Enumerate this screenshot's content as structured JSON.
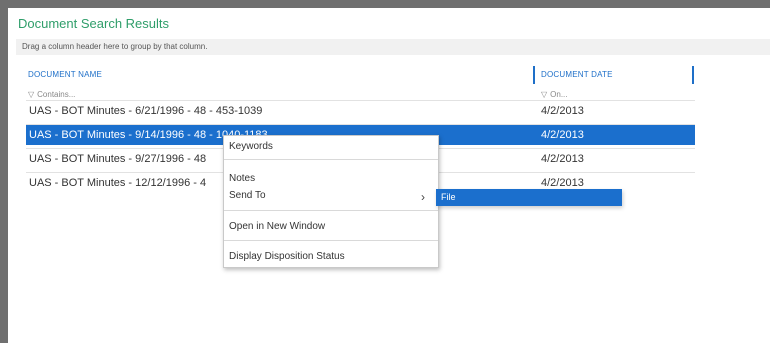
{
  "panel": {
    "title": "Document Search Results",
    "group_hint": "Drag a column header here to group by that column."
  },
  "columns": {
    "name": {
      "header": "DOCUMENT NAME",
      "filter_placeholder": "Contains..."
    },
    "date": {
      "header": "DOCUMENT DATE",
      "filter_placeholder": "On..."
    }
  },
  "rows": [
    {
      "name": "UAS - BOT Minutes - 6/21/1996 - 48 - 453-1039",
      "date": "4/2/2013"
    },
    {
      "name": "UAS - BOT Minutes - 9/14/1996 - 48 - 1040-1183",
      "date": "4/2/2013"
    },
    {
      "name": "UAS - BOT Minutes - 9/27/1996 - 48",
      "date": "4/2/2013"
    },
    {
      "name": "UAS - BOT Minutes - 12/12/1996 - 4",
      "date": "4/2/2013"
    }
  ],
  "context_menu": {
    "keywords": "Keywords",
    "notes": "Notes",
    "send_to": "Send To",
    "open_new_window": "Open in New Window",
    "display_disposition": "Display Disposition Status"
  },
  "submenu": {
    "file": "File"
  },
  "colors": {
    "title": "#2f9e6a",
    "accent": "#1b6fcd",
    "header": "#1e6fc8"
  },
  "icons": {
    "filter": "funnel-icon",
    "submenu_arrow": "chevron-right-icon"
  }
}
